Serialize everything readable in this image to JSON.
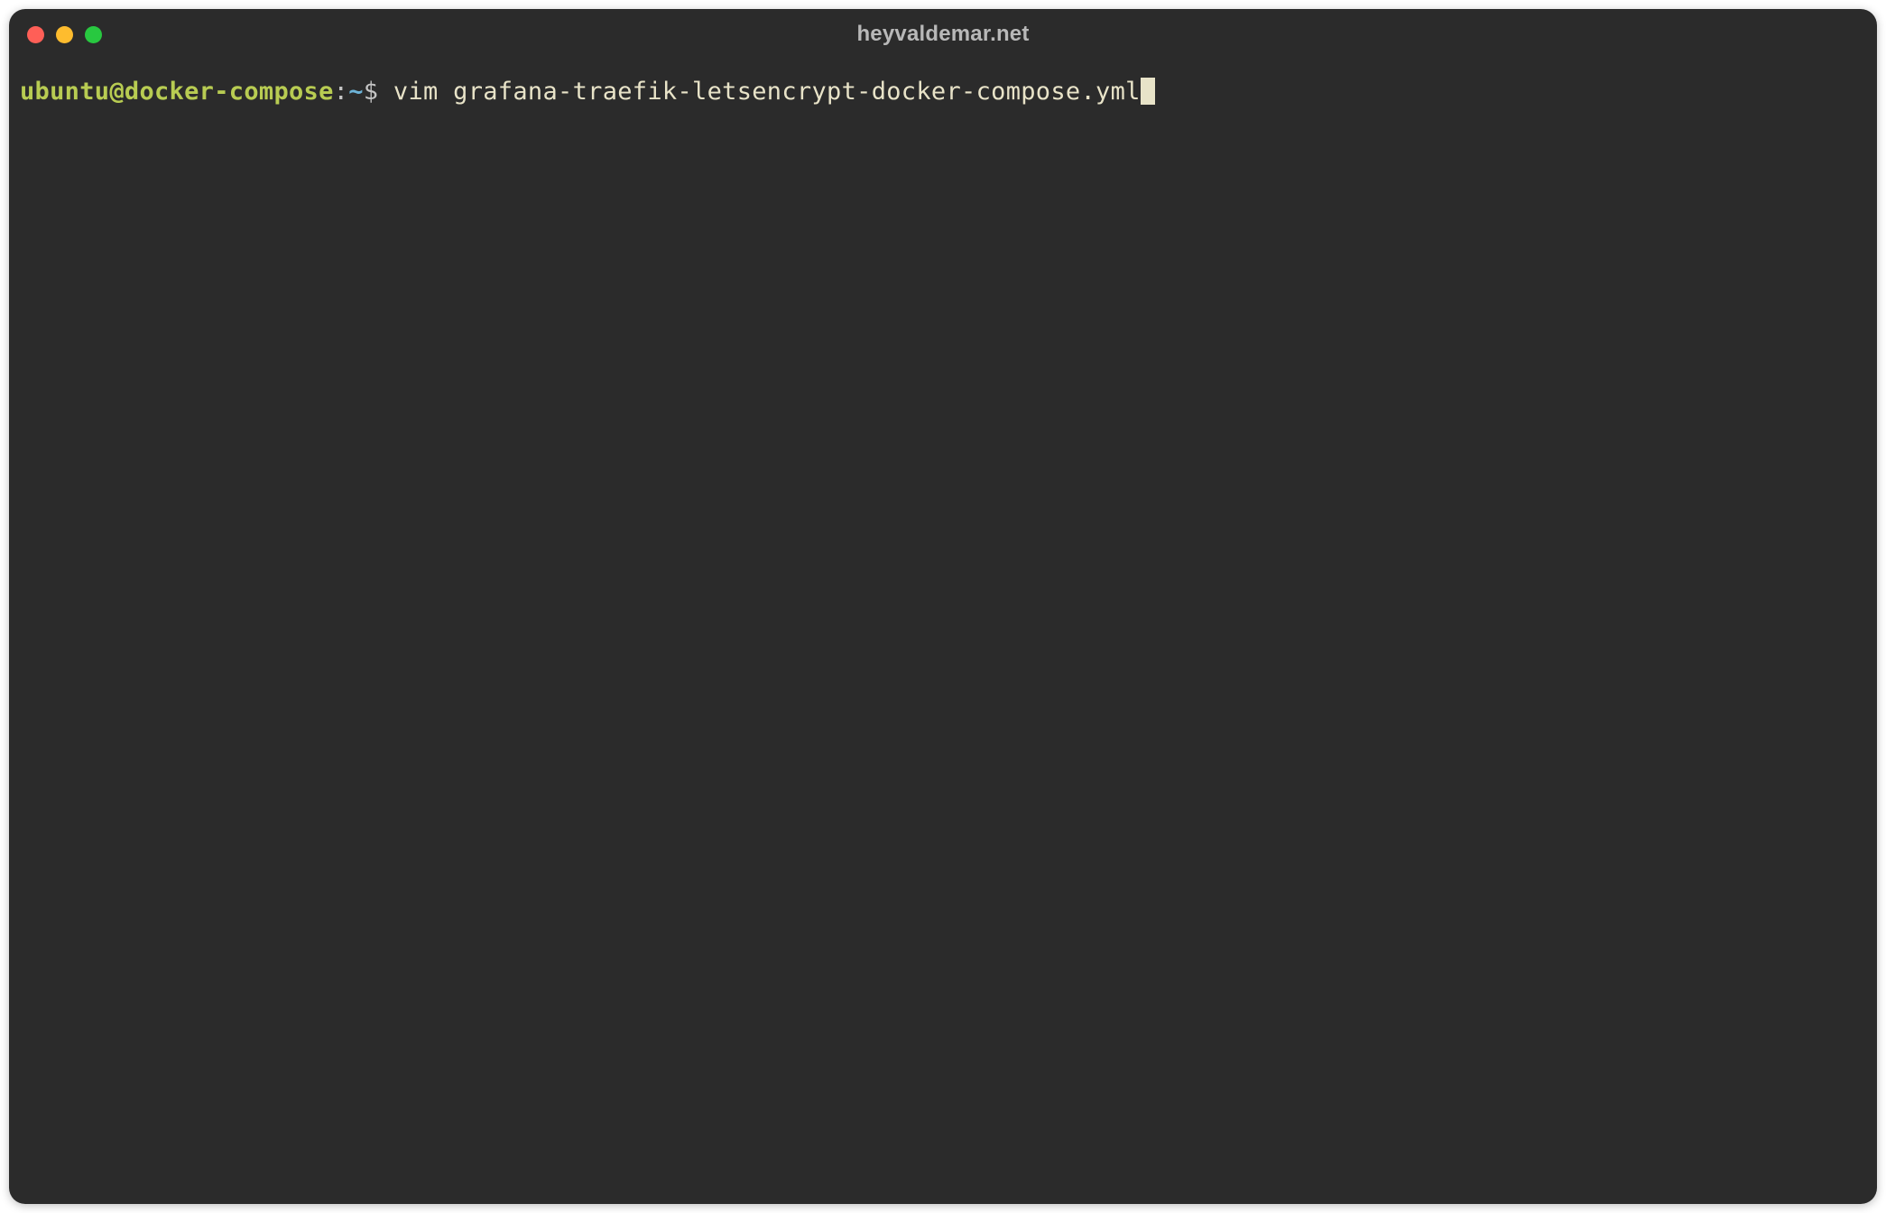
{
  "window": {
    "title": "heyvaldemar.net"
  },
  "prompt": {
    "user_host": "ubuntu@docker-compose",
    "separator": ":",
    "path": "~",
    "symbol": "$ "
  },
  "command": {
    "text": "vim grafana-traefik-letsencrypt-docker-compose.yml"
  },
  "colors": {
    "bg": "#2b2b2b",
    "prompt_user": "#b8cc52",
    "prompt_path": "#6db4d8",
    "command_text": "#e8e3c8",
    "title_text": "#b8b8b8",
    "close": "#ff5f57",
    "minimize": "#febc2e",
    "maximize": "#28c840"
  }
}
